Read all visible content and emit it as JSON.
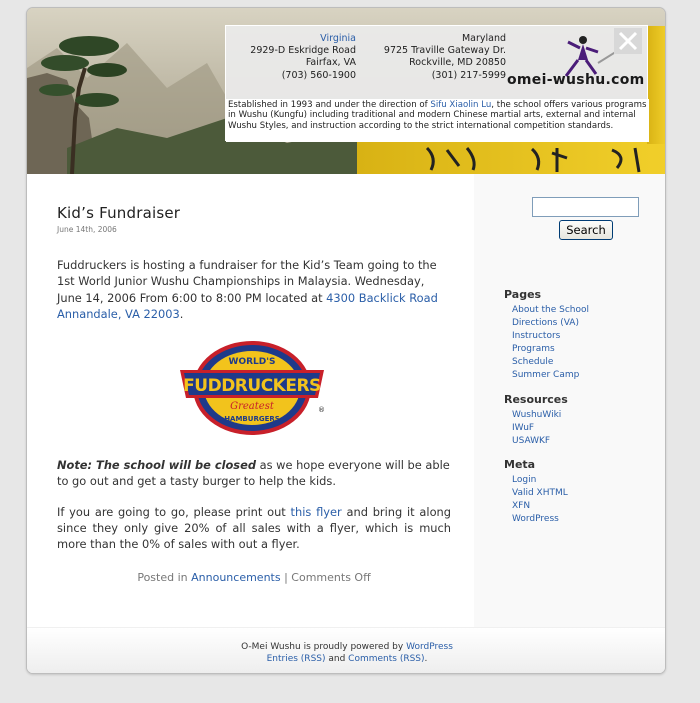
{
  "header": {
    "virginia": {
      "name": "Virginia",
      "address": "2929-D Eskridge Road",
      "city": "Fairfax, VA",
      "phone": "(703) 560-1900"
    },
    "maryland": {
      "name": "Maryland",
      "address": "9725 Traville Gateway Dr.",
      "city": "Rockville, MD 20850",
      "phone": "(301) 217-5999"
    },
    "site_name": "omei-wushu.com",
    "about_before": "Established in 1993 and under the direction of ",
    "about_link": "Sifu Xiaolin Lu",
    "about_after": ", the school offers various programs in Wushu (Kungfu) including traditional and modern Chinese martial arts, external and internal Wushu Styles, and instruction according to the strict international competition standards."
  },
  "post": {
    "title": "Kid’s Fundraiser",
    "date": "June 14th, 2006",
    "p1_text": "Fuddruckers is hosting a fundraiser for the Kid’s Team going to the 1st World Junior Wushu Championships in Malaysia. Wednesday, June 14, 2006 From 6:00 to 8:00 PM located at ",
    "p1_link": "4300 Backlick Road Annandale, VA 22003",
    "p1_end": ".",
    "logo": {
      "top_text": "WORLD'S",
      "main_text": "FUDDRUCKERS",
      "sub_text": "Greatest",
      "bottom_text": "HAMBURGERS",
      "registered": "®"
    },
    "note_bold": "Note: The school will be closed",
    "note_rest": " as we hope everyone will be able to go out and get a tasty burger to help the kids.",
    "p3_before": "If you are going to go, please print out ",
    "p3_link": "this flyer",
    "p3_after": " and bring it along since they only give 20% of all sales with a flyer, which is much more than the 0% of sales with out a flyer.",
    "meta_posted": "Posted in ",
    "meta_category": "Announcements",
    "meta_sep": " | ",
    "meta_comments": "Comments Off"
  },
  "sidebar": {
    "search_button": "Search",
    "search_value": "",
    "pages_title": "Pages",
    "pages": [
      "About the School",
      "Directions (VA)",
      "Instructors",
      "Programs",
      "Schedule",
      "Summer Camp"
    ],
    "resources_title": "Resources",
    "resources": [
      "WushuWiki",
      "IWuF",
      "USAWKF"
    ],
    "meta_title": "Meta",
    "meta": [
      "Login",
      "Valid XHTML",
      "XFN",
      "WordPress"
    ]
  },
  "footer": {
    "line1_before": "O-Mei Wushu is proudly powered by ",
    "line1_link": "WordPress",
    "entries_link": "Entries (RSS)",
    "and_text": " and ",
    "comments_link": "Comments (RSS)",
    "end": "."
  },
  "colors": {
    "link": "#2a5ea8",
    "banner_yellow": "#e8c21a",
    "background": "#e7e7e7"
  }
}
